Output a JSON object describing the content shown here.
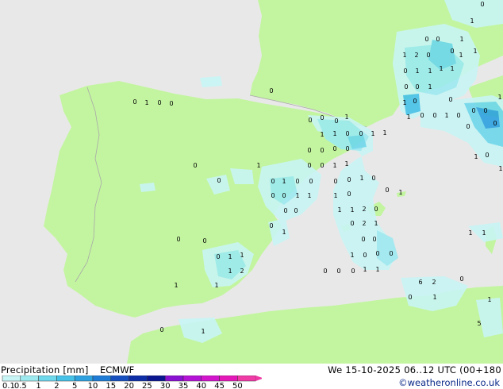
{
  "footer": {
    "legend_title": "Precipitation [mm]",
    "model": "ECMWF",
    "datetime": "We 15-10-2025 06..12 UTC (00+180",
    "credit": "©weatheronline.co.uk"
  },
  "legend": {
    "labels": [
      "0.1",
      "0.5",
      "1",
      "2",
      "5",
      "10",
      "15",
      "20",
      "25",
      "30",
      "35",
      "40",
      "45",
      "50"
    ],
    "colors": [
      "#c8f5f5",
      "#9ceaf0",
      "#6ed8ec",
      "#46c2e8",
      "#2ea2e0",
      "#1e7cd6",
      "#1650c0",
      "#0e2ea8",
      "#0a1690",
      "#8a10d2",
      "#b412d6",
      "#d214cc",
      "#e418b8",
      "#f03aa6"
    ]
  },
  "map": {
    "colors": {
      "sea": "#e8e8e8",
      "land": "#c3f5a0",
      "foreign_land": "#e6e6e6",
      "border": "#a8a8a8"
    },
    "value_labels": [
      "1",
      "0",
      "0",
      "1",
      "1",
      "2",
      "1",
      "0",
      "0",
      "1",
      "0",
      "1",
      "1",
      "1",
      "1",
      "0",
      "0",
      "1",
      "1",
      "0",
      "0",
      "1",
      "0",
      "0",
      "1",
      "0",
      "0",
      "0",
      "0",
      "0",
      "0",
      "1",
      "0",
      "0",
      "1",
      "0",
      "0",
      "0",
      "1",
      "0",
      "0",
      "0",
      "0",
      "1",
      "1",
      "1",
      "0",
      "0",
      "1",
      "1",
      "0",
      "0",
      "0",
      "0",
      "0",
      "0",
      "1",
      "1",
      "0",
      "1",
      "0",
      "0",
      "0",
      "0",
      "1",
      "0",
      "0",
      "1",
      "0",
      "0",
      "1",
      "1",
      "1",
      "0",
      "0",
      "0",
      "1",
      "1",
      "2",
      "0",
      "0",
      "1",
      "0",
      "2",
      "1",
      "0",
      "0",
      "1",
      "0",
      "0",
      "0",
      "0",
      "0",
      "0",
      "1",
      "1",
      "0",
      "0",
      "0",
      "1",
      "1",
      "1",
      "2",
      "1",
      "1",
      "6",
      "2",
      "0",
      "0",
      "1",
      "5",
      "1",
      "1",
      "0",
      "1",
      "0",
      "1",
      "1",
      "1"
    ]
  }
}
